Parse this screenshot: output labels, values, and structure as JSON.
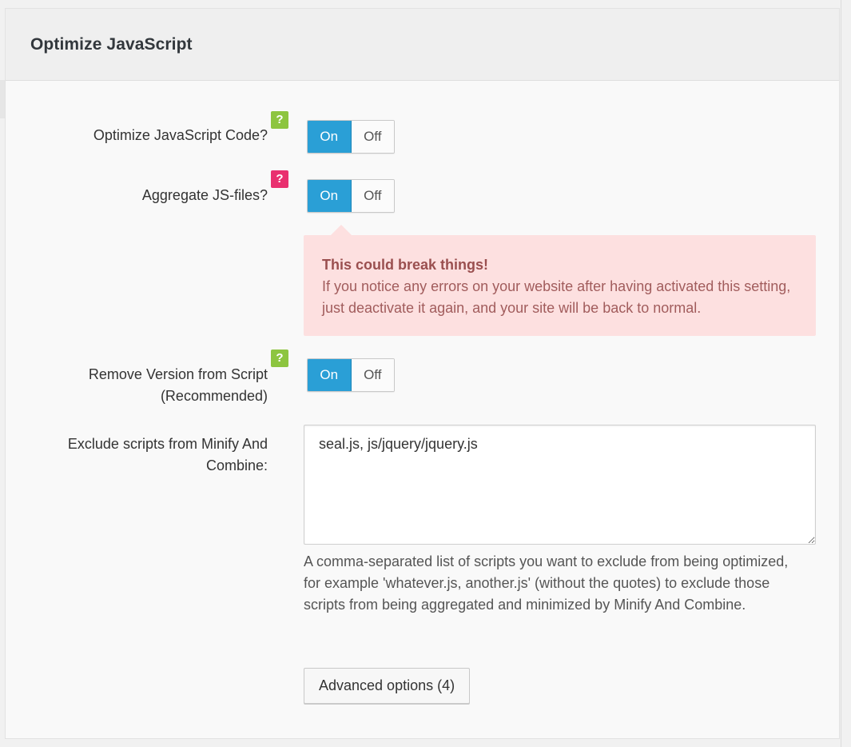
{
  "section": {
    "title": "Optimize JavaScript"
  },
  "settings": [
    {
      "label": "Optimize JavaScript Code?",
      "help_icon": "question-mark",
      "help_color": "#8dc540",
      "on_label": "On",
      "off_label": "Off",
      "state": "On"
    },
    {
      "label": "Aggregate JS-files?",
      "help_icon": "question-mark",
      "help_color": "#e9306f",
      "on_label": "On",
      "off_label": "Off",
      "state": "On"
    },
    {
      "label_line1": "Remove Version from Script",
      "label_line2": "(Recommended)",
      "help_icon": "question-mark",
      "help_color": "#8dc540",
      "on_label": "On",
      "off_label": "Off",
      "state": "On"
    }
  ],
  "help_glyph": "?",
  "warning": {
    "title": "This could break things!",
    "body": "If you notice any errors on your website after having activated this setting, just deactivate it again, and your site will be back to normal."
  },
  "exclude": {
    "label_line1": "Exclude scripts from Minify And",
    "label_line2": "Combine:",
    "value": "seal.js, js/jquery/jquery.js",
    "description": "A comma-separated list of scripts you want to exclude from being optimized, for example 'whatever.js, another.js' (without the quotes) to exclude those scripts from being aggregated and minimized by Minify And Combine."
  },
  "advanced_button": "Advanced options (4)",
  "colors": {
    "toggle_on": "#2a9fd6",
    "warning_bg": "#fde0e0",
    "warning_text": "#a15c5c"
  }
}
